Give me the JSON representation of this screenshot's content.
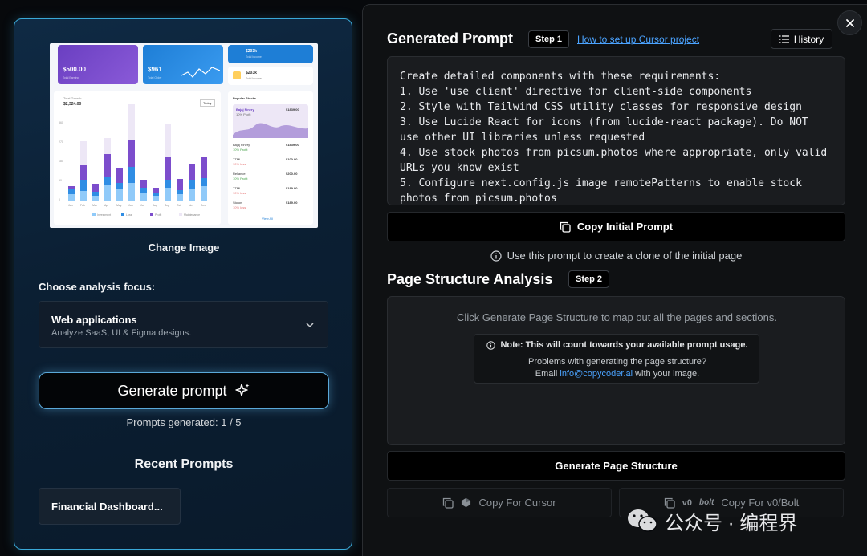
{
  "left": {
    "thumbnail": {
      "card1_value": "$500.00",
      "card1_sub": "Total Earning",
      "card2_value": "$961",
      "card2_sub": "Total Order",
      "card3_value": "$203k",
      "card3_sub": "Total Income",
      "card4_value": "$203k",
      "card4_sub": "Total Income",
      "chart_title": "Total Growth",
      "chart_amount": "$2,324.00",
      "chart_filter": "Today",
      "side_title": "Popular Stocks",
      "side_featured": "Bajaj Finery",
      "side_featured_value": "$1839.00",
      "side_featured_sub": "10% Profit",
      "stocks": [
        {
          "name": "Bajaj Finery",
          "value": "$1839.00",
          "sub": "10% Profit"
        },
        {
          "name": "TTML",
          "value": "$100.00",
          "sub": "10% loss"
        },
        {
          "name": "Reliance",
          "value": "$200.00",
          "sub": "10% Profit"
        },
        {
          "name": "TTML",
          "value": "$189.00",
          "sub": "10% loss"
        },
        {
          "name": "Stolon",
          "value": "$189.00",
          "sub": "10% loss"
        }
      ],
      "view_all": "View All",
      "months": [
        "Jan",
        "Feb",
        "Mar",
        "Apr",
        "May",
        "Jun",
        "Jul",
        "Aug",
        "Sep",
        "Oct",
        "Nov",
        "Dec"
      ],
      "legend": [
        "Investment",
        "Loss",
        "Profit",
        "Maintenance"
      ],
      "y_ticks": [
        "360",
        "270",
        "180",
        "90",
        "0"
      ]
    },
    "change_image": "Change Image",
    "focus_label": "Choose analysis focus:",
    "focus_title": "Web applications",
    "focus_sub": "Analyze SaaS, UI & Figma designs.",
    "generate_label": "Generate prompt",
    "prompts_generated": "Prompts generated: 1 / 5",
    "recent_title": "Recent Prompts",
    "recent_items": [
      "Financial Dashboard..."
    ]
  },
  "right": {
    "generated_title": "Generated Prompt",
    "step1": "Step 1",
    "cursor_link": "How to set up Cursor project",
    "history": "History",
    "prompt_text": "Create detailed components with these requirements:\n1. Use 'use client' directive for client-side components\n2. Style with Tailwind CSS utility classes for responsive design\n3. Use Lucide React for icons (from lucide-react package). Do NOT use other UI libraries unless requested\n4. Use stock photos from picsum.photos where appropriate, only valid URLs you know exist\n5. Configure next.config.js image remotePatterns to enable stock photos from picsum.photos",
    "copy_initial": "Copy Initial Prompt",
    "use_note": "Use this prompt to create a clone of the initial page",
    "structure_title": "Page Structure Analysis",
    "step2": "Step 2",
    "structure_hint": "Click Generate Page Structure to map out all the pages and sections.",
    "note_bold": "Note: This will count towards your available prompt usage.",
    "note_problem": "Problems with generating the page structure?",
    "note_email_prefix": "Email",
    "note_email": "info@copycoder.ai",
    "note_email_suffix": "with your image.",
    "generate_structure": "Generate Page Structure",
    "copy_cursor": "Copy For Cursor",
    "copy_v0": "Copy For v0/Bolt",
    "v0_logo": "v0",
    "bolt_logo": "bolt"
  },
  "watermark": "公众号 · 编程界",
  "colors": {
    "accent_blue": "#3aa9d8",
    "link_blue": "#4ba3ff",
    "purple": "#7c4dcc",
    "blue_bar": "#2f8de4",
    "light_blue_bar": "#90caf9"
  },
  "icons": {
    "close": "close-icon",
    "history": "list-icon",
    "copy": "copy-icon",
    "info": "info-icon",
    "sparkle": "sparkle-icon",
    "chevron": "chevron-down-icon"
  }
}
